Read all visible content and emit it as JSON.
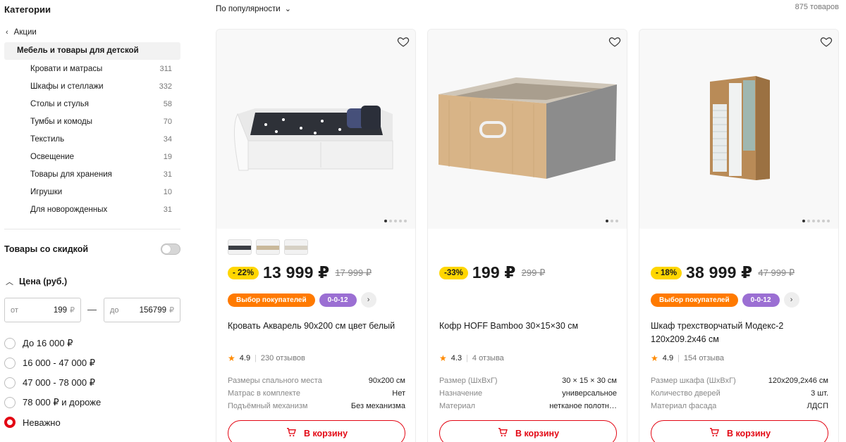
{
  "sidebar": {
    "title": "Категории",
    "back_label": "Акции",
    "active": "Мебель и товары для детской",
    "items": [
      {
        "label": "Кровати и матрасы",
        "count": "311"
      },
      {
        "label": "Шкафы и стеллажи",
        "count": "332"
      },
      {
        "label": "Столы и стулья",
        "count": "58"
      },
      {
        "label": "Тумбы и комоды",
        "count": "70"
      },
      {
        "label": "Текстиль",
        "count": "34"
      },
      {
        "label": "Освещение",
        "count": "19"
      },
      {
        "label": "Товары для хранения",
        "count": "31"
      },
      {
        "label": "Игрушки",
        "count": "10"
      },
      {
        "label": "Для новорожденных",
        "count": "31"
      }
    ],
    "sale_label": "Товары со скидкой",
    "sale_enabled": false,
    "price": {
      "title": "Цена (руб.)",
      "from_prefix": "от",
      "from_value": "199",
      "to_prefix": "до",
      "to_value": "156799",
      "currency": "₽",
      "dash": "—",
      "options": [
        {
          "label": "До 16 000 ₽",
          "selected": false
        },
        {
          "label": "16 000 - 47 000 ₽",
          "selected": false
        },
        {
          "label": "47 000 - 78 000 ₽",
          "selected": false
        },
        {
          "label": "78 000 ₽ и дороже",
          "selected": false
        },
        {
          "label": "Неважно",
          "selected": true
        }
      ]
    }
  },
  "toolbar": {
    "sort_label": "По популярности",
    "total": "875 товаров"
  },
  "colors": {
    "accent": "#e30613",
    "discount": "#ffd600",
    "orange_tag": "#ff7a00",
    "purple_tag": "#9b6fd3"
  },
  "products": [
    {
      "discount": "- 22%",
      "price": "13 999 ₽",
      "old_price": "17 999 ₽",
      "tags": [
        "Выбор покупателей",
        "0-0-12"
      ],
      "name": "Кровать Акварель 90x200 см цвет белый",
      "rating": "4.9",
      "reviews": "230 отзывов",
      "specs": [
        {
          "k": "Размеры спального места",
          "v": "90x200 см"
        },
        {
          "k": "Матрас в комплекте",
          "v": "Нет"
        },
        {
          "k": "Подъёмный механизм",
          "v": "Без механизма"
        }
      ],
      "cart_label": "В корзину"
    },
    {
      "discount": "-33%",
      "price": "199 ₽",
      "old_price": "299 ₽",
      "tags": [],
      "name": "Кофр HOFF Bamboo 30×15×30 см",
      "rating": "4.3",
      "reviews": "4 отзыва",
      "specs": [
        {
          "k": "Размер (ШxВxГ)",
          "v": "30 × 15 × 30 см"
        },
        {
          "k": "Назначение",
          "v": "универсальное"
        },
        {
          "k": "Материал",
          "v": "нетканое полотн…"
        }
      ],
      "cart_label": "В корзину"
    },
    {
      "discount": "- 18%",
      "price": "38 999 ₽",
      "old_price": "47 999 ₽",
      "tags": [
        "Выбор покупателей",
        "0-0-12"
      ],
      "name": "Шкаф трехстворчатый Модекс-2 120x209.2x46 см",
      "rating": "4.9",
      "reviews": "154 отзыва",
      "specs": [
        {
          "k": "Размер шкафа (ШxВxГ)",
          "v": "120x209,2x46 см"
        },
        {
          "k": "Количество дверей",
          "v": "3 шт."
        },
        {
          "k": "Материал фасада",
          "v": "ЛДСП"
        }
      ],
      "cart_label": "В корзину"
    }
  ]
}
